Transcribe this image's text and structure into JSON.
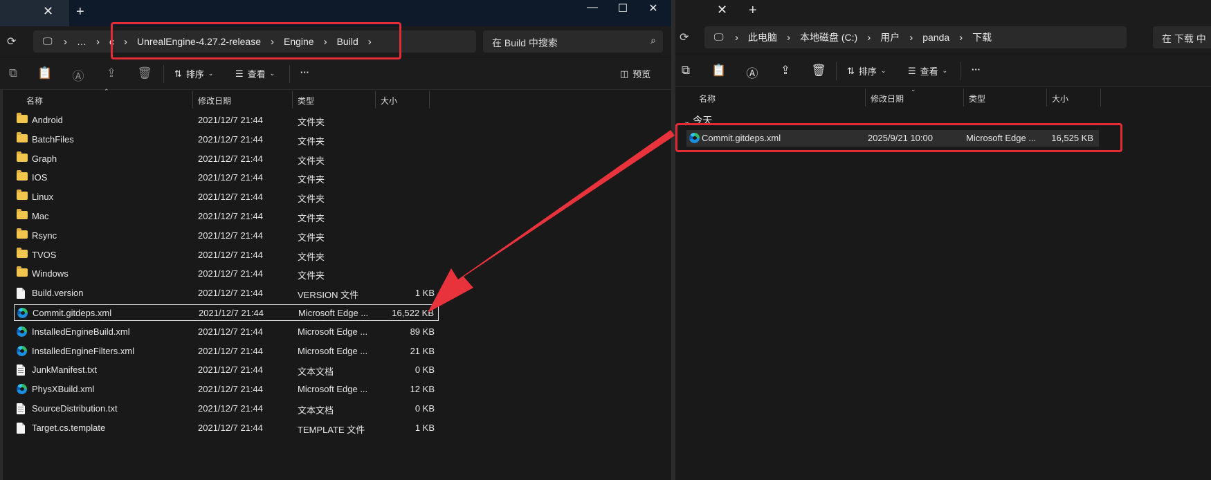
{
  "left": {
    "address": {
      "crumbs": [
        "…",
        "c",
        "UnrealEngine-4.27.2-release",
        "Engine",
        "Build"
      ]
    },
    "search_placeholder": "在 Build 中搜索",
    "toolbar": {
      "sort": "排序",
      "view": "查看",
      "more": "···",
      "preview": "预览"
    },
    "columns": {
      "name": "名称",
      "date": "修改日期",
      "type": "类型",
      "size": "大小"
    },
    "files": [
      {
        "name": "Android",
        "date": "2021/12/7 21:44",
        "type": "文件夹",
        "size": "",
        "icon": "folder-icon"
      },
      {
        "name": "BatchFiles",
        "date": "2021/12/7 21:44",
        "type": "文件夹",
        "size": "",
        "icon": "folder-icon"
      },
      {
        "name": "Graph",
        "date": "2021/12/7 21:44",
        "type": "文件夹",
        "size": "",
        "icon": "folder-icon"
      },
      {
        "name": "IOS",
        "date": "2021/12/7 21:44",
        "type": "文件夹",
        "size": "",
        "icon": "folder-icon"
      },
      {
        "name": "Linux",
        "date": "2021/12/7 21:44",
        "type": "文件夹",
        "size": "",
        "icon": "folder-icon"
      },
      {
        "name": "Mac",
        "date": "2021/12/7 21:44",
        "type": "文件夹",
        "size": "",
        "icon": "folder-icon"
      },
      {
        "name": "Rsync",
        "date": "2021/12/7 21:44",
        "type": "文件夹",
        "size": "",
        "icon": "folder-icon"
      },
      {
        "name": "TVOS",
        "date": "2021/12/7 21:44",
        "type": "文件夹",
        "size": "",
        "icon": "folder-icon"
      },
      {
        "name": "Windows",
        "date": "2021/12/7 21:44",
        "type": "文件夹",
        "size": "",
        "icon": "folder-icon"
      },
      {
        "name": "Build.version",
        "date": "2021/12/7 21:44",
        "type": "VERSION 文件",
        "size": "1 KB",
        "icon": "file-icon"
      },
      {
        "name": "Commit.gitdeps.xml",
        "date": "2021/12/7 21:44",
        "type": "Microsoft Edge ...",
        "size": "16,522 KB",
        "icon": "edge-icon"
      },
      {
        "name": "InstalledEngineBuild.xml",
        "date": "2021/12/7 21:44",
        "type": "Microsoft Edge ...",
        "size": "89 KB",
        "icon": "edge-icon"
      },
      {
        "name": "InstalledEngineFilters.xml",
        "date": "2021/12/7 21:44",
        "type": "Microsoft Edge ...",
        "size": "21 KB",
        "icon": "edge-icon"
      },
      {
        "name": "JunkManifest.txt",
        "date": "2021/12/7 21:44",
        "type": "文本文档",
        "size": "0 KB",
        "icon": "text-file-icon"
      },
      {
        "name": "PhysXBuild.xml",
        "date": "2021/12/7 21:44",
        "type": "Microsoft Edge ...",
        "size": "12 KB",
        "icon": "edge-icon"
      },
      {
        "name": "SourceDistribution.txt",
        "date": "2021/12/7 21:44",
        "type": "文本文档",
        "size": "0 KB",
        "icon": "text-file-icon"
      },
      {
        "name": "Target.cs.template",
        "date": "2021/12/7 21:44",
        "type": "TEMPLATE 文件",
        "size": "1 KB",
        "icon": "file-icon"
      }
    ]
  },
  "right": {
    "address": {
      "crumbs": [
        "此电脑",
        "本地磁盘 (C:)",
        "用户",
        "panda",
        "下载"
      ]
    },
    "search_placeholder": "在 下载 中",
    "toolbar": {
      "sort": "排序",
      "view": "查看",
      "more": "···"
    },
    "columns": {
      "name": "名称",
      "date": "修改日期",
      "type": "类型",
      "size": "大小"
    },
    "group": "今天",
    "files": [
      {
        "name": "Commit.gitdeps.xml",
        "date": "2025/9/21 10:00",
        "type": "Microsoft Edge ...",
        "size": "16,525 KB",
        "icon": "edge-icon"
      }
    ]
  },
  "colors": {
    "highlight_red": "#e52c36",
    "arrow_red": "#e8323c",
    "background": "#191919"
  }
}
